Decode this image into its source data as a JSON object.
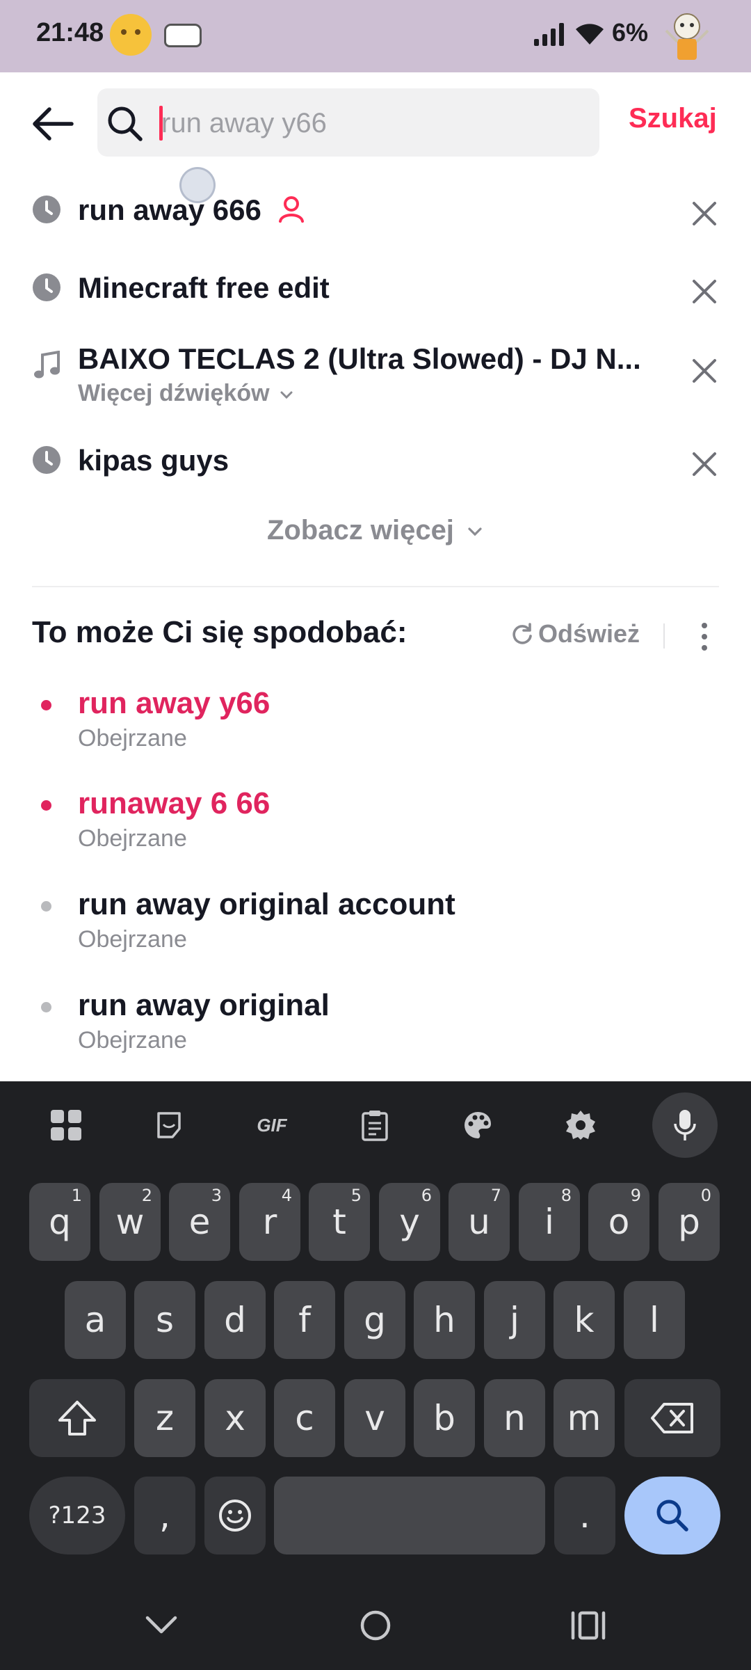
{
  "status_bar": {
    "time": "21:48",
    "battery": "6%"
  },
  "search": {
    "placeholder": "run away y66",
    "button_label": "Szukaj"
  },
  "history": [
    {
      "label": "run away 666",
      "icon": "clock-icon",
      "has_user_badge": true
    },
    {
      "label": "Minecraft free edit",
      "icon": "clock-icon"
    },
    {
      "label": "BAIXO TECLAS 2 (Ultra Slowed) - DJ N...",
      "icon": "music-note-icon",
      "sub": "Więcej dźwięków"
    },
    {
      "label": "kipas guys",
      "icon": "clock-icon"
    }
  ],
  "see_more_label": "Zobacz więcej",
  "suggestions_section": {
    "title": "To może Ci się spodobać:",
    "refresh_label": "Odśwież",
    "items": [
      {
        "label": "run away y66",
        "sub": "Obejrzane",
        "highlight": true
      },
      {
        "label": "runaway 6 66",
        "sub": "Obejrzane",
        "highlight": true
      },
      {
        "label": "run away original account",
        "sub": "Obejrzane",
        "highlight": false
      },
      {
        "label": "run away original",
        "sub": "Obejrzane",
        "highlight": false
      }
    ]
  },
  "keyboard": {
    "row1": [
      "q",
      "w",
      "e",
      "r",
      "t",
      "y",
      "u",
      "i",
      "o",
      "p"
    ],
    "row1_nums": [
      "1",
      "2",
      "3",
      "4",
      "5",
      "6",
      "7",
      "8",
      "9",
      "0"
    ],
    "row2": [
      "a",
      "s",
      "d",
      "f",
      "g",
      "h",
      "j",
      "k",
      "l"
    ],
    "row3": [
      "z",
      "x",
      "c",
      "v",
      "b",
      "n",
      "m"
    ],
    "symbols_label": "?123",
    "comma": ",",
    "period": ".",
    "gif_label": "GIF"
  },
  "colors": {
    "accent": "#fe2c55",
    "highlight_text": "#e0245e",
    "status_bar_bg": "#cdbfd3",
    "keyboard_bg": "#1f2023",
    "search_key": "#a8c7fa"
  }
}
